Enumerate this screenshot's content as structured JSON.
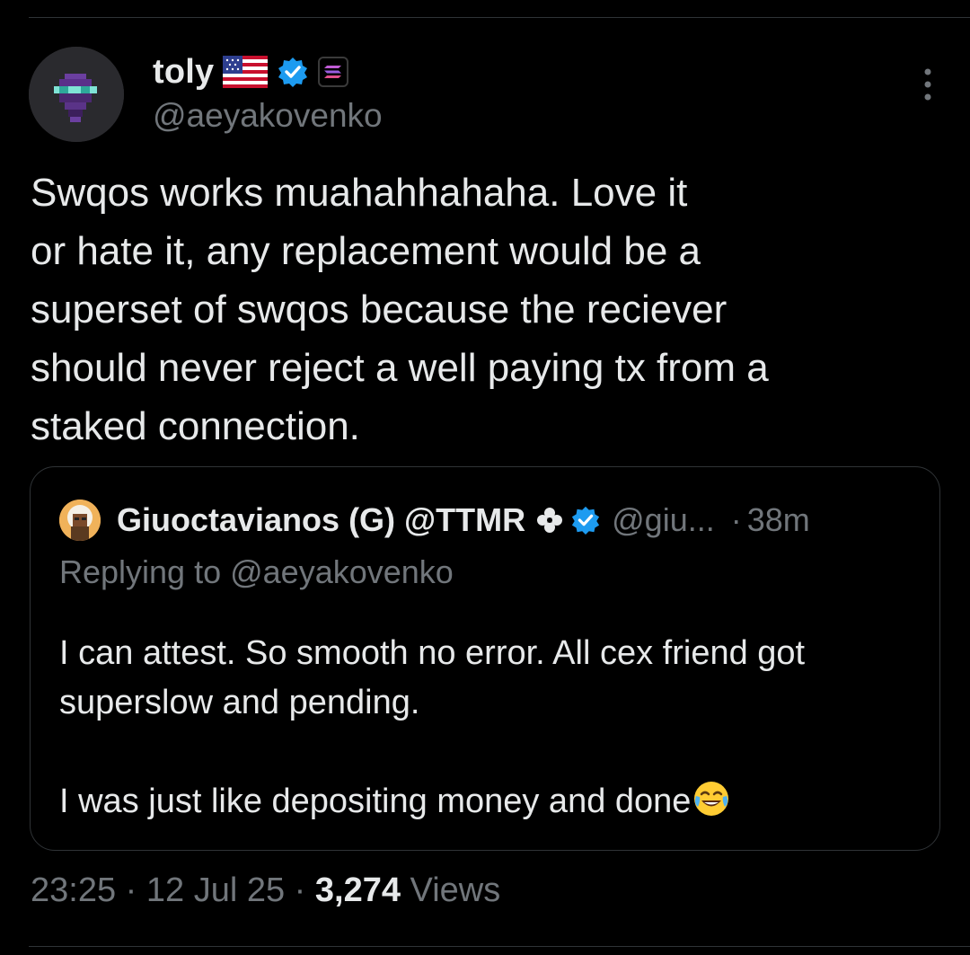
{
  "author": {
    "display_name": "toly",
    "handle": "@aeyakovenko",
    "flag_icon": "us-flag-icon",
    "verified_icon": "verified-badge-icon",
    "affiliate_icon": "solana-logo-icon"
  },
  "tweet": {
    "text": "Swqos works muahahhahaha.  Love it\nor hate it, any replacement would be a\nsuperset of swqos because the reciever\nshould never reject a well paying tx from a\nstaked connection."
  },
  "quote": {
    "display_name": "Giuoctavianos (G) @TTMR",
    "clover_icon": "clover-icon",
    "verified_icon": "verified-badge-icon",
    "handle": "@giu...",
    "separator": "·",
    "time": "38m",
    "replying_prefix": "Replying to ",
    "replying_handle": "@aeyakovenko",
    "line1": "I can attest. So smooth no error. All cex friend got",
    "line2": "superslow and pending.",
    "line3": "I was just like depositing money and done",
    "emoji": "face-with-tears-of-joy-icon"
  },
  "meta": {
    "time": "23:25",
    "sep1": " · ",
    "date": "12 Jul 25",
    "sep2": " · ",
    "views_count": "3,274",
    "views_label": " Views"
  },
  "colors": {
    "background": "#000000",
    "text": "#e7e9ea",
    "muted": "#71767b",
    "border": "#2f3336",
    "verified": "#1d9bf0"
  }
}
